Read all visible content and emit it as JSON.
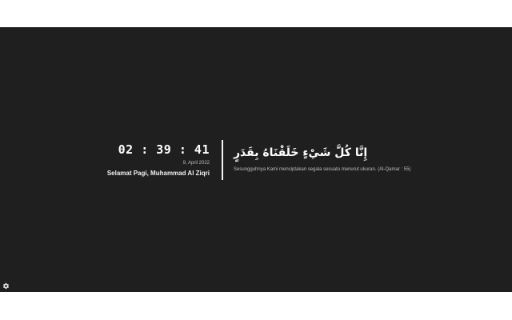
{
  "clock": {
    "time": "02 : 39 : 41",
    "date": "9, April 2022"
  },
  "greeting": "Selamat Pagi, Muhammad Al Ziqri",
  "verse": {
    "arabic": "إِنَّا كُلَّ شَيْءٍ خَلَقْنَاهُ بِقَدَرٍ",
    "translation": "Sesungguhnya Kami menciptakan segala sesuatu menurut ukuran. (Al-Qamar : 55)"
  },
  "icons": {
    "settings": "gear-icon"
  },
  "colors": {
    "background": "#1f1f1f",
    "text": "#ffffff",
    "muted": "#bdbdbd"
  }
}
